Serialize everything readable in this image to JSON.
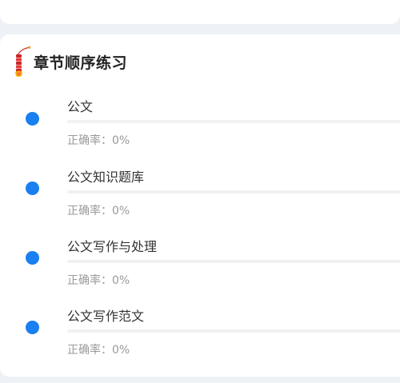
{
  "section": {
    "title": "章节顺序练习",
    "icon": "firecracker-icon",
    "accent_color": "#1a7ff0"
  },
  "chapters": [
    {
      "name": "公文",
      "accuracy_label": "正确率：",
      "accuracy_value": "0%",
      "progress": 0
    },
    {
      "name": "公文知识题库",
      "accuracy_label": "正确率：",
      "accuracy_value": "0%",
      "progress": 0
    },
    {
      "name": "公文写作与处理",
      "accuracy_label": "正确率：",
      "accuracy_value": "0%",
      "progress": 0
    },
    {
      "name": "公文写作范文",
      "accuracy_label": "正确率：",
      "accuracy_value": "0%",
      "progress": 0
    }
  ]
}
